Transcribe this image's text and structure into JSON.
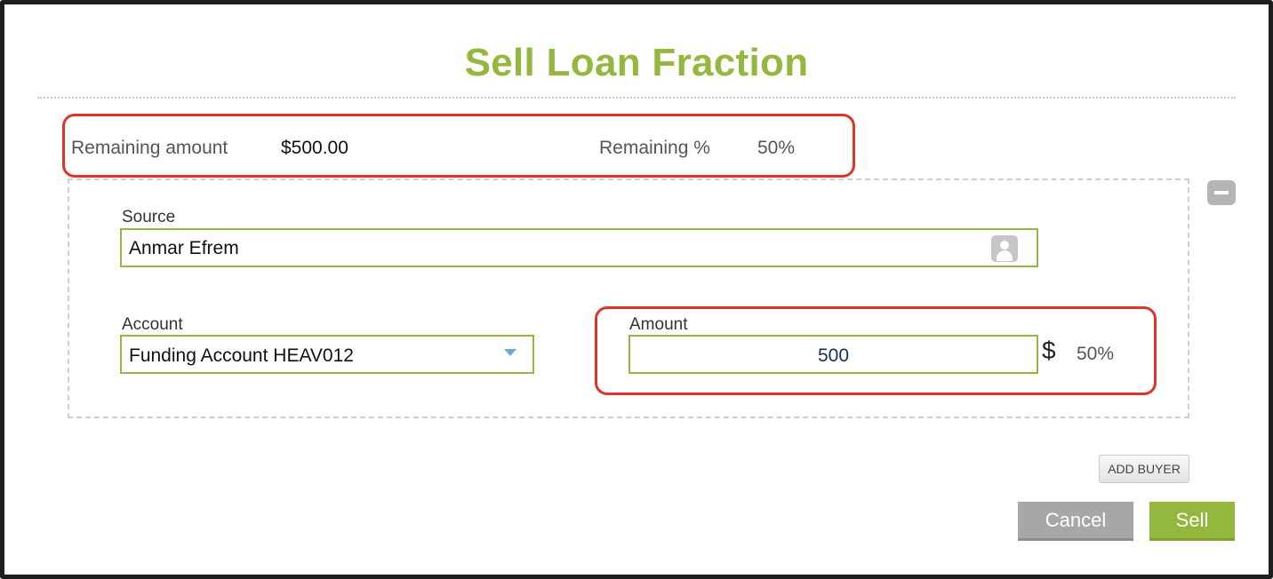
{
  "dialog": {
    "title": "Sell Loan Fraction"
  },
  "summary": {
    "remaining_amount_label": "Remaining amount",
    "remaining_amount_value": "$500.00",
    "remaining_pct_label": "Remaining %",
    "remaining_pct_value": "50%"
  },
  "buyer": {
    "source_label": "Source",
    "source_value": "Anmar Efrem",
    "account_label": "Account",
    "account_value": "Funding Account HEAV012",
    "amount_label": "Amount",
    "amount_value": "500",
    "currency_symbol": "$",
    "amount_pct": "50%"
  },
  "actions": {
    "add_buyer_label": "ADD BUYER",
    "cancel_label": "Cancel",
    "sell_label": "Sell"
  },
  "icons": {
    "remove_buyer": "minus-icon",
    "source_picker": "person-icon",
    "account_dropdown": "chevron-down-icon"
  },
  "colors": {
    "accent": "#94b83e",
    "highlight": "#e0342a",
    "cancel_button": "#a7a7a7"
  }
}
